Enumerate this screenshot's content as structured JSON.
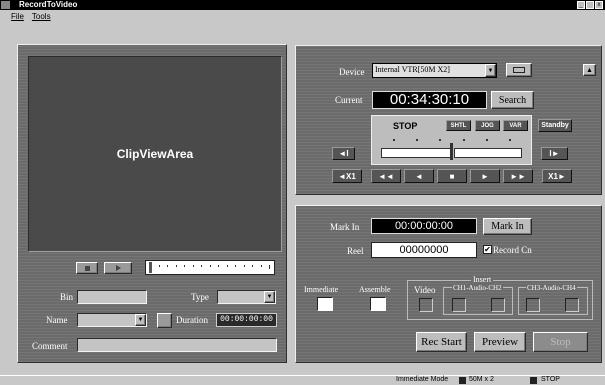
{
  "window": {
    "title": "RecordToVideo",
    "app_icon": "app-icon",
    "controls": [
      "_",
      "□",
      "x"
    ]
  },
  "menu": {
    "items": [
      "File",
      "Tools"
    ]
  },
  "left": {
    "clip_view_label": "ClipViewArea",
    "bin_label": "Bin",
    "type_label": "Type",
    "name_label": "Name",
    "duration_label": "Duration",
    "duration_value": "00:00:00:00",
    "comment_label": "Comment"
  },
  "device": {
    "label": "Device",
    "value": "Internal VTR[50M X2]",
    "current_label": "Current",
    "current_value": "00:34:30:10",
    "search_label": "Search",
    "state": "STOP",
    "shtl": "SHTL",
    "jog": "JOG",
    "var": "VAR",
    "standby": "Standby",
    "transport": [
      "◄X1",
      "◄◄",
      "◄",
      "■",
      "►",
      "►►",
      "X1►"
    ],
    "step_back": "◄I",
    "step_fwd": "I►"
  },
  "record": {
    "mark_in_label": "Mark In",
    "mark_in_value": "00:00:00:00",
    "mark_in_button": "Mark In",
    "reel_label": "Reel",
    "reel_value": "00000000",
    "record_cn_label": "Record Cn",
    "immediate_label": "Immediate",
    "assemble_label": "Assemble",
    "insert_label": "Insert",
    "video_label": "Video",
    "ch12_label": "CH1-Audio-CH2",
    "ch34_label": "CH3-Audio-CH4",
    "rec_start": "Rec Start",
    "preview": "Preview",
    "stop": "Stop"
  },
  "status": {
    "mode": "Immediate Mode",
    "format": "50M x 2",
    "state": "STOP"
  }
}
